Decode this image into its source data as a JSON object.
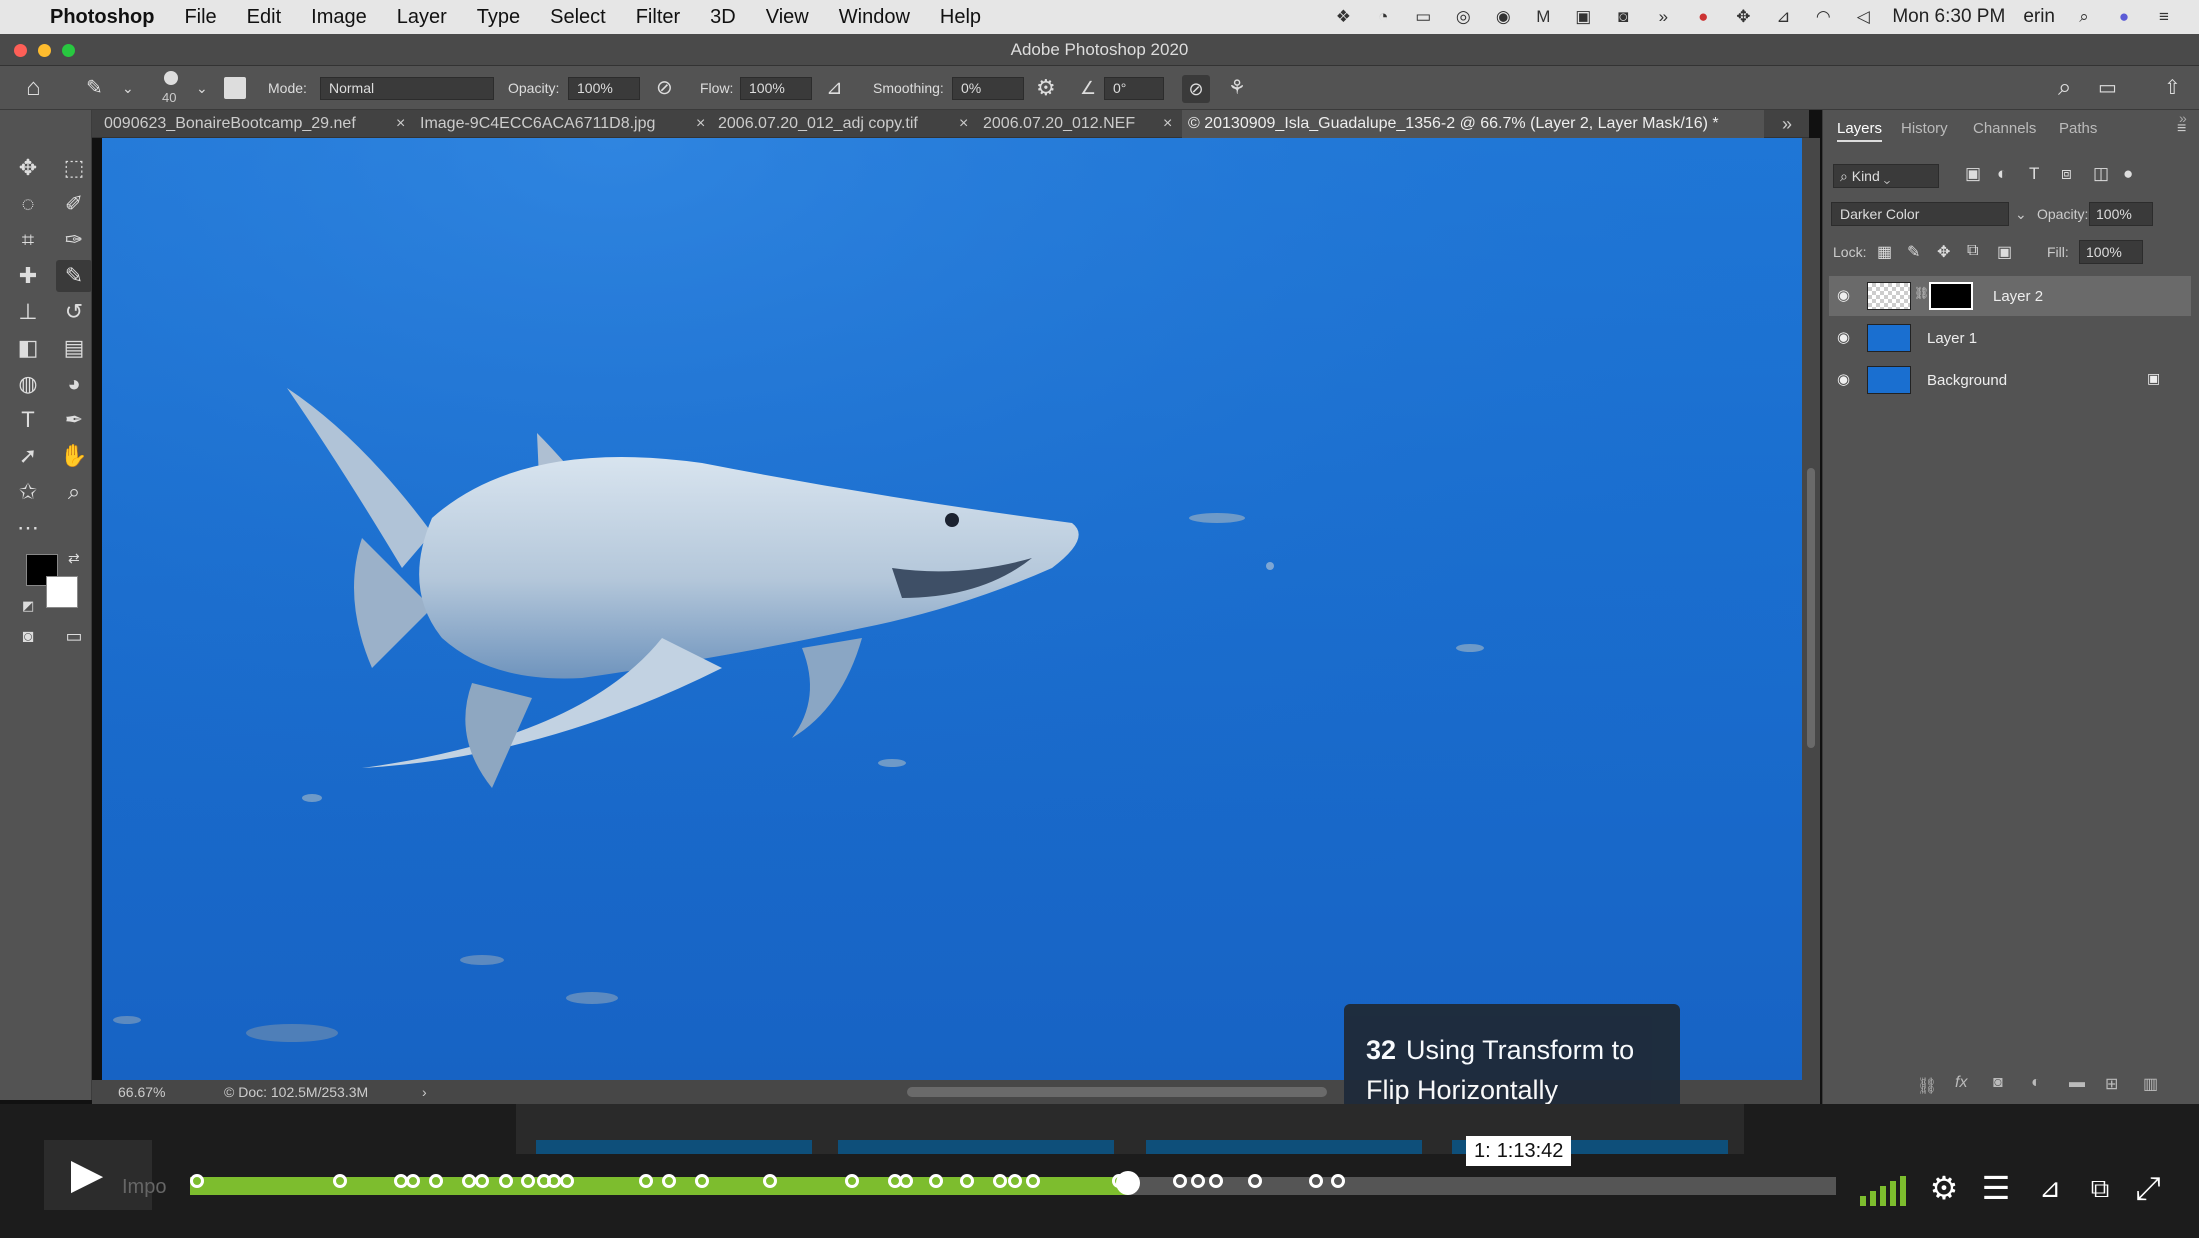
{
  "menubar": {
    "app_name": "Photoshop",
    "items": [
      "File",
      "Edit",
      "Image",
      "Layer",
      "Type",
      "Select",
      "Filter",
      "3D",
      "View",
      "Window",
      "Help"
    ],
    "clock": "Mon 6:30 PM",
    "user": "erin"
  },
  "window": {
    "title": "Adobe Photoshop 2020"
  },
  "options": {
    "brush_size": "40",
    "mode_label": "Mode:",
    "mode_value": "Normal",
    "opacity_label": "Opacity:",
    "opacity_value": "100%",
    "flow_label": "Flow:",
    "flow_value": "100%",
    "smoothing_label": "Smoothing:",
    "smoothing_value": "0%",
    "angle_value": "0°"
  },
  "tabs": [
    {
      "label": "0090623_BonaireBootcamp_29.nef"
    },
    {
      "label": "Image-9C4ECC6ACA6711D8.jpg"
    },
    {
      "label": "2006.07.20_012_adj copy.tif"
    },
    {
      "label": "2006.07.20_012.NEF"
    },
    {
      "label": "© 20130909_Isla_Guadalupe_1356-2 @ 66.7% (Layer 2, Layer Mask/16) *"
    }
  ],
  "tab_close_glyph": "×",
  "status": {
    "zoom": "66.67%",
    "doc": "© Doc: 102.5M/253.3M",
    "arrow": "›"
  },
  "panel": {
    "tabs": [
      "Layers",
      "History",
      "Channels",
      "Paths"
    ],
    "kind_label": "Kind",
    "blend_mode": "Darker Color",
    "opacity_label": "Opacity:",
    "opacity_value": "100%",
    "lock_label": "Lock:",
    "fill_label": "Fill:",
    "fill_value": "100%",
    "layers": [
      {
        "name": "Layer 2",
        "selected": true
      },
      {
        "name": "Layer 1",
        "selected": false
      },
      {
        "name": "Background",
        "selected": false
      }
    ]
  },
  "video": {
    "chapter_number": "32",
    "chapter_title": "Using Transform to Flip Horizontally",
    "tooltip_time": "1:13:42",
    "tooltip_prefix": "1:",
    "progress_played": 0.57,
    "player_watermark": "Impo",
    "chapter_fractions": [
      0,
      0.087,
      0.124,
      0.131,
      0.145,
      0.165,
      0.173,
      0.188,
      0.201,
      0.211,
      0.217,
      0.225,
      0.273,
      0.287,
      0.307,
      0.348,
      0.398,
      0.424,
      0.431,
      0.449,
      0.468,
      0.488,
      0.497,
      0.508,
      0.56,
      0.597,
      0.608,
      0.619,
      0.643,
      0.68,
      0.693
    ]
  },
  "icons": {
    "apple": "",
    "home": "⌂",
    "brush": "🖌",
    "gear": "⚙",
    "eye": "👁",
    "lock": "🔒",
    "search": "⌕",
    "play": "▶",
    "settings": "⚙",
    "list": "☰",
    "fullscreen": "⤢"
  },
  "colors": {
    "accent_progress": "#7dbd2e",
    "canvas_blue": "#1a6fd0"
  }
}
